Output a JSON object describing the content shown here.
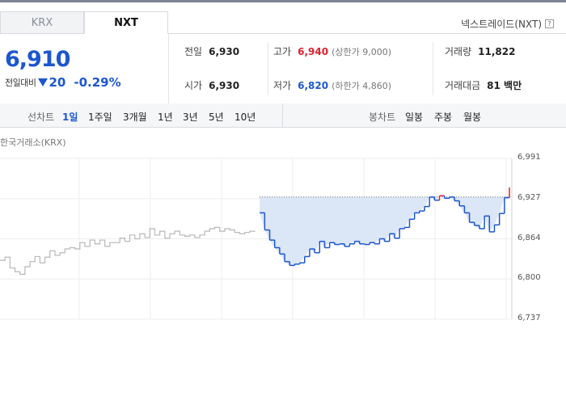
{
  "tabs": [
    {
      "label": "KRX",
      "active": false
    },
    {
      "label": "NXT",
      "active": true
    }
  ],
  "header": {
    "nxt_title": "넥스트레이드(NXT)",
    "help_icon": "?"
  },
  "price": {
    "current": "6,910",
    "change_label": "전일대비",
    "change_amount": "20",
    "change_percent": "-0.29%",
    "direction": "down"
  },
  "stats": {
    "prev_close": {
      "label": "전일",
      "value": "6,930"
    },
    "open": {
      "label": "시가",
      "value": "6,930"
    },
    "high": {
      "label": "고가",
      "value": "6,940",
      "sub": "(상한가 9,000)"
    },
    "low": {
      "label": "저가",
      "value": "6,820",
      "sub": "(하한가 4,860)"
    },
    "volume": {
      "label": "거래량",
      "value": "11,822"
    },
    "amount": {
      "label": "거래대금",
      "value": "81 백만"
    }
  },
  "period_bar": {
    "line_label": "선차트",
    "line_periods": [
      "1일",
      "1주일",
      "3개월",
      "1년",
      "3년",
      "5년",
      "10년"
    ],
    "active_period": "1일",
    "candle_label": "봉차트",
    "candle_periods": [
      "일봉",
      "주봉",
      "월봉"
    ]
  },
  "chart_caption": "한국거래소(KRX)",
  "chart_data": {
    "type": "line",
    "title": "",
    "ylim": [
      6737,
      6991
    ],
    "y_ticks": [
      "6,991",
      "6,927",
      "6,864",
      "6,800",
      "6,737"
    ],
    "reference_value": 6930,
    "colors": {
      "krx": "#b8b8b8",
      "above": "#e0202a",
      "below": "#1c57d0",
      "fill": "#dbe6f7",
      "grid": "#eeeeee",
      "reference": "#666666"
    },
    "series": [
      {
        "source": "KRX",
        "x": [
          0,
          1,
          2,
          3,
          4,
          5,
          6,
          7,
          8,
          9,
          10,
          11,
          12,
          13,
          14,
          15,
          16,
          17,
          18,
          19,
          20,
          21,
          22,
          23,
          24,
          25,
          26,
          27,
          28,
          29,
          30,
          31,
          32,
          33,
          34,
          35,
          36,
          37,
          38,
          39,
          40,
          41,
          42,
          43,
          44,
          45,
          46,
          47,
          48,
          49,
          50,
          51
        ],
        "values": [
          6830,
          6835,
          6818,
          6812,
          6808,
          6820,
          6828,
          6836,
          6826,
          6835,
          6845,
          6838,
          6842,
          6848,
          6850,
          6848,
          6858,
          6852,
          6862,
          6856,
          6862,
          6852,
          6858,
          6858,
          6865,
          6860,
          6870,
          6864,
          6872,
          6866,
          6880,
          6870,
          6876,
          6865,
          6872,
          6876,
          6870,
          6868,
          6870,
          6866,
          6870,
          6876,
          6880,
          6882,
          6876,
          6880,
          6878,
          6874,
          6872,
          6874,
          6876,
          6877
        ]
      },
      {
        "source": "NXT",
        "x": [
          52,
          53,
          54,
          55,
          56,
          57,
          58,
          59,
          60,
          61,
          62,
          63,
          64,
          65,
          66,
          67,
          68,
          69,
          70,
          71,
          72,
          73,
          74,
          75,
          76,
          77,
          78,
          79,
          80,
          81,
          82,
          83,
          84,
          85,
          86,
          87,
          88,
          89,
          90,
          91,
          92,
          93,
          94,
          95,
          96,
          97,
          98,
          99,
          100,
          101,
          102
        ],
        "values": [
          6905,
          6878,
          6862,
          6850,
          6840,
          6828,
          6822,
          6824,
          6826,
          6836,
          6848,
          6842,
          6860,
          6850,
          6858,
          6855,
          6856,
          6852,
          6856,
          6860,
          6856,
          6855,
          6858,
          6856,
          6864,
          6860,
          6872,
          6865,
          6880,
          6882,
          6895,
          6905,
          6908,
          6915,
          6930,
          6925,
          6932,
          6928,
          6930,
          6924,
          6916,
          6905,
          6890,
          6885,
          6880,
          6900,
          6875,
          6886,
          6904,
          6929,
          6945
        ]
      }
    ]
  }
}
